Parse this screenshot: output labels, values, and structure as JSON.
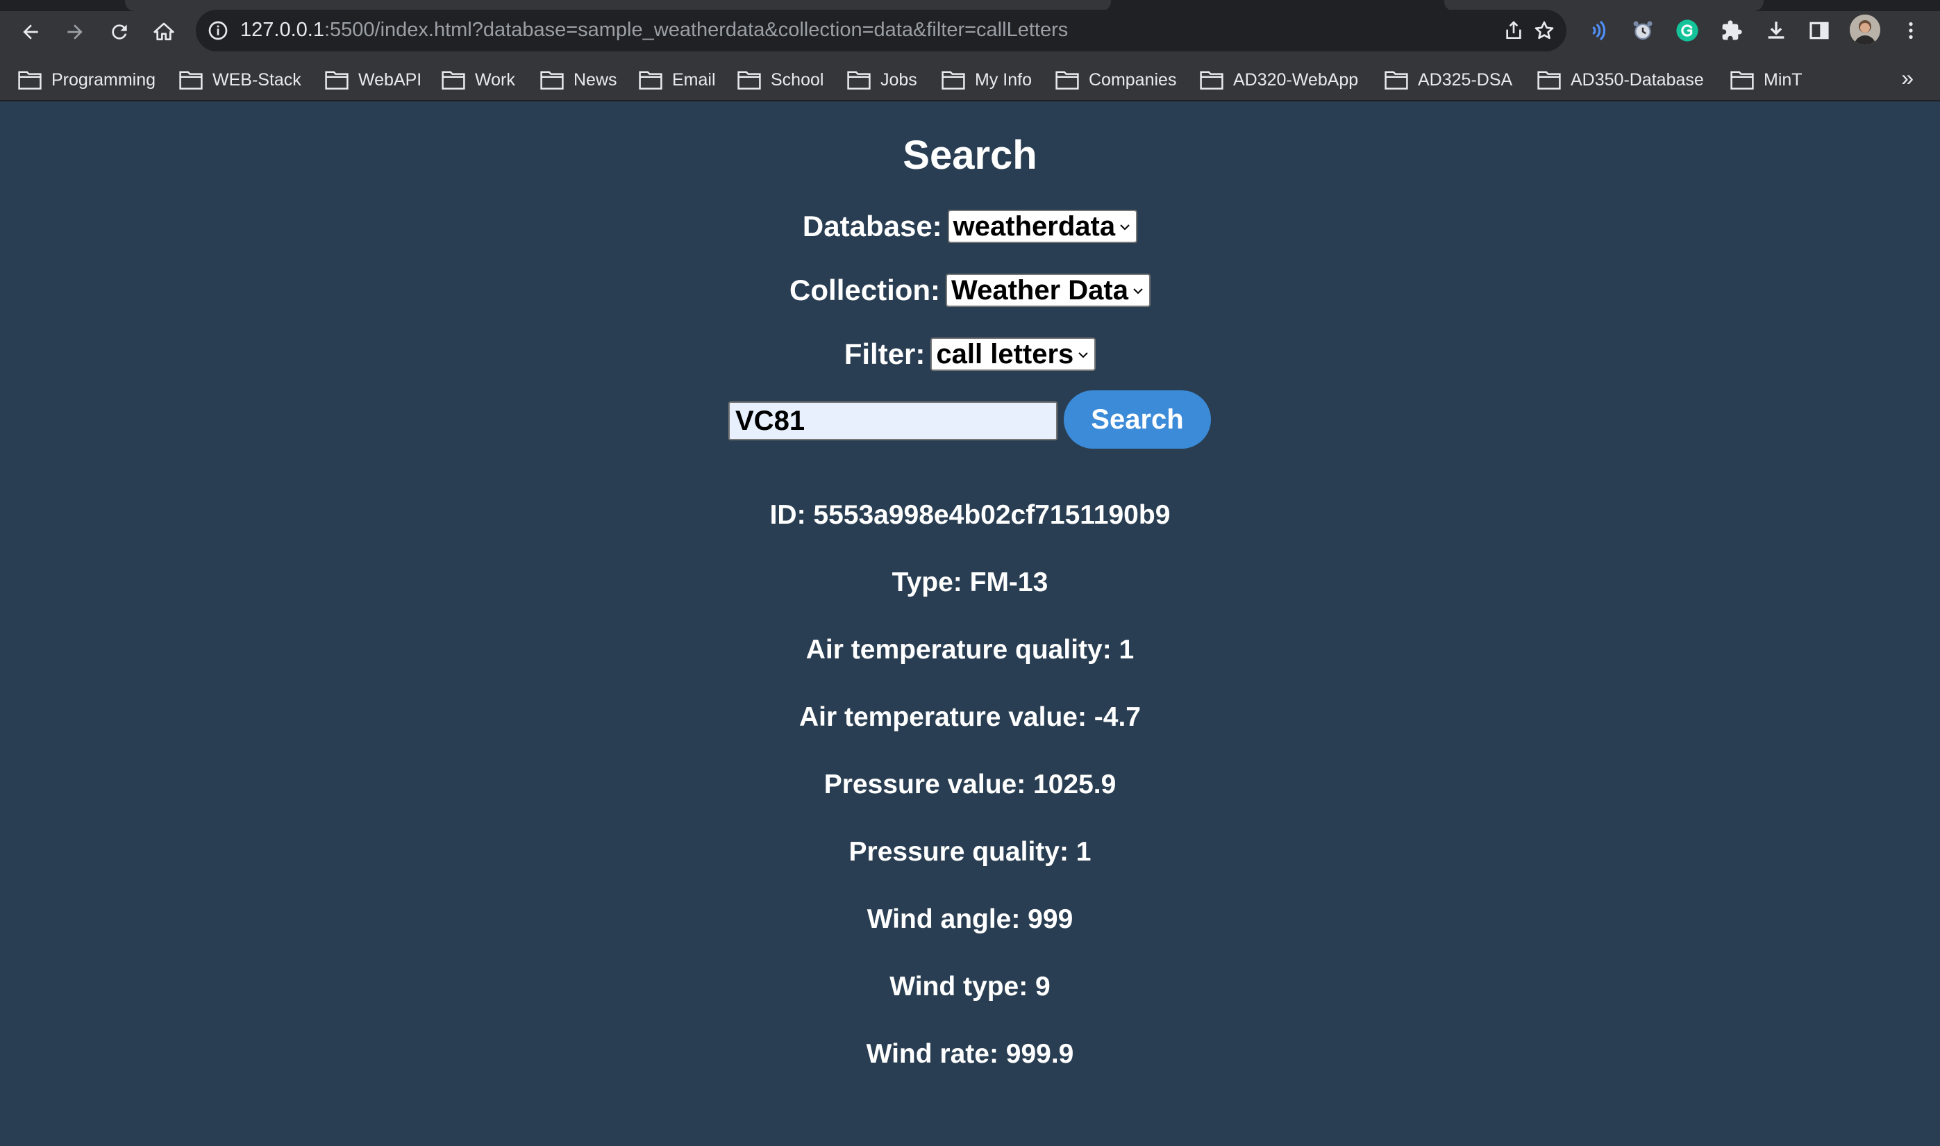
{
  "browser": {
    "url_host": "127.0.0.1",
    "url_rest": ":5500/index.html?database=sample_weatherdata&collection=data&filter=callLetters",
    "icons": {
      "back": "arrow-left-icon",
      "forward": "arrow-right-icon",
      "reload": "reload-icon",
      "home": "home-icon",
      "info": "info-icon",
      "share": "share-icon",
      "bookmark": "star-icon",
      "menu": "more-vert-icon"
    }
  },
  "bookmarks": {
    "items": [
      {
        "label": "Programming"
      },
      {
        "label": "WEB-Stack"
      },
      {
        "label": "WebAPI"
      },
      {
        "label": "Work"
      },
      {
        "label": "News"
      },
      {
        "label": "Email"
      },
      {
        "label": "School"
      },
      {
        "label": "Jobs"
      },
      {
        "label": "My Info"
      },
      {
        "label": "Companies"
      },
      {
        "label": "AD320-WebApp"
      },
      {
        "label": "AD325-DSA"
      },
      {
        "label": "AD350-Database"
      },
      {
        "label": "MinT"
      }
    ],
    "overflow": "»"
  },
  "page": {
    "title": "Search",
    "database": {
      "label": "Database:",
      "value": "weatherdata"
    },
    "collection": {
      "label": "Collection:",
      "value": "Weather Data"
    },
    "filter": {
      "label": "Filter:",
      "value": "call letters"
    },
    "search": {
      "value": "VC81",
      "button": "Search"
    },
    "results": [
      "ID: 5553a998e4b02cf7151190b9",
      "Type: FM-13",
      "Air temperature quality: 1",
      "Air temperature value: -4.7",
      "Pressure value: 1025.9",
      "Pressure quality: 1",
      "Wind angle: 999",
      "Wind type: 9",
      "Wind rate: 999.9"
    ]
  },
  "colors": {
    "page_bg": "#293e52",
    "button_bg": "#3b8bd8",
    "input_bg": "#e8f0fe"
  }
}
